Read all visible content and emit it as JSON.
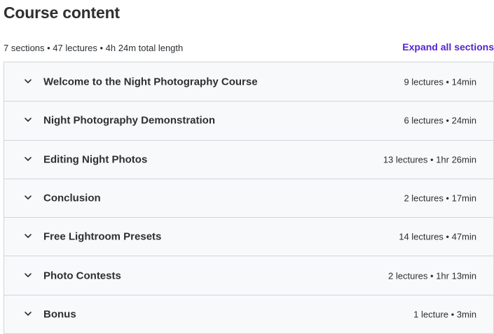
{
  "header": {
    "title": "Course content",
    "summary": "7 sections • 47 lectures • 4h 24m total length",
    "expand_label": "Expand all sections"
  },
  "sections": [
    {
      "title": "Welcome to the Night Photography Course",
      "info": "9 lectures • 14min"
    },
    {
      "title": "Night Photography Demonstration",
      "info": "6 lectures • 24min"
    },
    {
      "title": "Editing Night Photos",
      "info": "13 lectures • 1hr 26min"
    },
    {
      "title": "Conclusion",
      "info": "2 lectures • 17min"
    },
    {
      "title": "Free Lightroom Presets",
      "info": "14 lectures • 47min"
    },
    {
      "title": "Photo Contests",
      "info": "2 lectures • 1hr 13min"
    },
    {
      "title": "Bonus",
      "info": "1 lecture • 3min"
    }
  ],
  "icons": {
    "section_toggle": "chevron-down-icon"
  },
  "colors": {
    "accent": "#5624d0",
    "panel_bg": "#f7f9fa",
    "border": "#d1d7dc",
    "text": "#2d2f31"
  }
}
